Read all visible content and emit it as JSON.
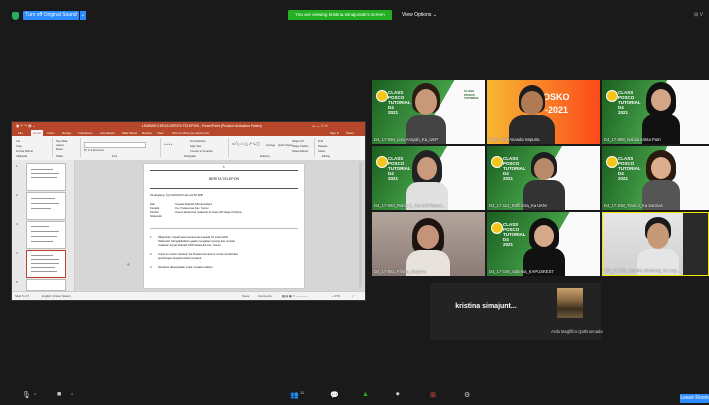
{
  "topbar": {
    "turn_off_sound": "Turn off Original Sound",
    "caret": "⌄",
    "share_banner": "You are viewing kristina.simajuntak's screen",
    "view_options": "View Options ⌄",
    "view_right": "⊞ V",
    "share_color": "#23b123",
    "accent_color": "#2d8cff"
  },
  "ppt": {
    "title": "LEMBAR KERJA BERITA TELEPON - PowerPoint (Product Activation Failed)",
    "tabs": [
      "File",
      "Home",
      "Insert",
      "Design",
      "Transitions",
      "Animations",
      "Slide Show",
      "Review",
      "View"
    ],
    "active_tab": "Home",
    "tell_me": "Tell me what you want to do",
    "sign_in": "Sign in",
    "share": "Share",
    "ribbon": {
      "clipboard": [
        "Cut",
        "Copy",
        "Format Painter"
      ],
      "paste": "Paste",
      "slides": [
        "New Slide",
        "Layout",
        "Reset",
        "Section"
      ],
      "paragraph": [
        "Text Direction",
        "Align Text",
        "Convert to SmartArt"
      ],
      "arrange": "Arrange",
      "quick_styles": "Quick Styles",
      "editing": [
        "Find",
        "Replace",
        "Select"
      ],
      "shape": [
        "Shape Fill",
        "Shape Outline",
        "Shape Effects"
      ],
      "groups": [
        "Clipboard",
        "Slides",
        "Font",
        "Paragraph",
        "Drawing",
        "Editing"
      ]
    },
    "slide_numbers": [
      "1",
      "2",
      "3",
      "4",
      "5"
    ],
    "slide": {
      "heading": "BERITA TELEPON",
      "line_date": "Pendeglang, Tgl 11/10/2019 Jam 10:50 WIB",
      "dari_label": "Dari",
      "dari_val": ": Kepala Sekolah SD Nusantara",
      "kepada_label": "Kepada",
      "kepada_val": ": Ka. Puskesmas Kec. Sumur",
      "perihal_label": "Perihal",
      "perihal_val": ": Kasus keracunan makanan di  siswa SD Negeri di Desa",
      "perihal_val2": "Sidamukti",
      "item1": "Dilaporkan, terjadi kasus keracunan kepada 34  siswa SDN",
      "item1b": "Sidamukti. Mengakibatkan gejala mengalami pusing dan muntah",
      "item1c": "makanan di jual Sekolah SDN Sidamukti Kec. Sumur.",
      "item2": "Untuk itu mohon bantuan Ka Puskesmas Sumur untuk memberikan",
      "item2b": "pertolongan kepada korban tersebut.",
      "item3": "Demikian disampaikan untuk menjadi maklum."
    },
    "status": {
      "slide_of": "Slide 5 of 5",
      "language": "English (United States)",
      "notes": "Notes",
      "comments": "Comments",
      "zoom": "+ 47%"
    }
  },
  "tiles": [
    {
      "name": "D4_17-058_Lisa Ansyah_Ka_UKP"
    },
    {
      "name": "Host - Dwi Ananda Seputra"
    },
    {
      "name": "D4_17-089_Nabila Arinta Putri"
    },
    {
      "name": "D4_17-063_Rabia C_Ka Unit Rawat..."
    },
    {
      "name": "D4_17-114_Raffi Esa_Ka UKM"
    },
    {
      "name": "D4_17-038_Tiara J_Ka Sarmas"
    },
    {
      "name": "D4_17-061_Frisha_Kaputra"
    },
    {
      "name": "D4_17-105_Sabrina_KAPUSKES7"
    },
    {
      "name": "D4_17-106_Jeremia Sitohang_Ka Log..."
    }
  ],
  "posters": {
    "main": [
      "CLASS",
      "POSCO",
      "TUTORIAL",
      "D4",
      "2021"
    ],
    "host_banner": "POSKO",
    "host_year": "-2021"
  },
  "participants": {
    "kristina": "kristina simajunt...",
    "arda": "Arda Magfifira Qathrunnada"
  },
  "bottombar": {
    "mic": "🎙",
    "video": "■",
    "participants": "👥",
    "participants_count": "11",
    "chat": "💬",
    "share": "▲",
    "record": "⏺",
    "reactions": "⊞",
    "settings": "⚙",
    "leave": "Leave Room"
  }
}
